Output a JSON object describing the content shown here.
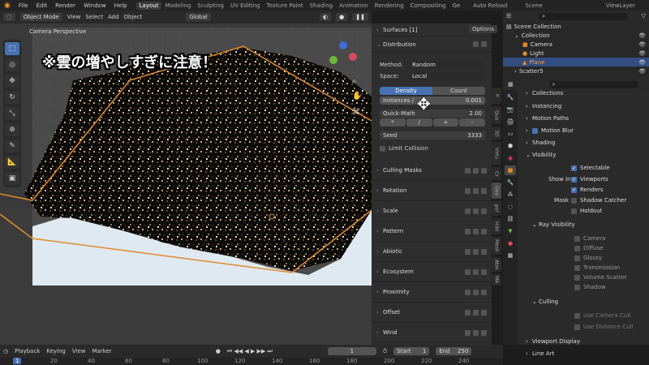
{
  "topbar": {
    "menus": [
      "File",
      "Edit",
      "Render",
      "Window",
      "Help"
    ],
    "workspaces": [
      "Layout",
      "Modeling",
      "Sculpting",
      "UV Editing",
      "Texture Paint",
      "Shading",
      "Animation",
      "Rendering",
      "Compositing",
      "Ge"
    ],
    "auto_reload": "Auto Reload",
    "scene": "Scene",
    "viewlayer": "ViewLayer"
  },
  "viewport": {
    "mode": "Object Mode",
    "menus": [
      "View",
      "Select",
      "Add",
      "Object"
    ],
    "transform": "Global",
    "options": "Options",
    "overlay_text": "※雲の増やしすぎに注意！",
    "camera_label": "Camera Perspective",
    "side_tabs": [
      "P",
      "Qua",
      "3D",
      "Virtu",
      "Cr",
      "Geo",
      "pol",
      "Hdri",
      "Mesh",
      "Atm",
      "MA"
    ]
  },
  "npanel": {
    "surfaces": "Surfaces [1]",
    "distribution": "Distribution",
    "method_label": "Method:",
    "method_value": "Random",
    "space_label": "Space:",
    "space_value": "Local",
    "tab_density": "Density",
    "tab_count": "Count",
    "instances_label": "Instances /",
    "instances_value": "0.001",
    "quickmath": "Quick-Math",
    "quickmath_value": "2.00",
    "ops": [
      "*",
      "/",
      "+",
      "-"
    ],
    "seed_label": "Seed",
    "seed_value": "3333",
    "limit_collision": "Limit Collision",
    "sections": [
      "Culling Masks",
      "Rotation",
      "Scale",
      "Pattern",
      "Abiotic",
      "Ecosystem",
      "Proximity",
      "Offset",
      "Wind"
    ]
  },
  "outliner": {
    "search_placeholder": "",
    "rows": [
      {
        "label": "Scene Collection"
      },
      {
        "label": "Collection"
      },
      {
        "label": "Camera"
      },
      {
        "label": "Light"
      },
      {
        "label": "Plane"
      },
      {
        "label": "Scatter5"
      }
    ]
  },
  "props": {
    "sections_top": [
      "Collections",
      "Instancing",
      "Motion Paths",
      "Motion Blur",
      "Shading",
      "Visibility"
    ],
    "selectable": "Selectable",
    "show_in": "Show In",
    "viewports": "Viewports",
    "renders": "Renders",
    "mask": "Mask",
    "shadow_catcher": "Shadow Catcher",
    "holdout": "Holdout",
    "ray_visibility": "Ray Visibility",
    "rays": [
      "Camera",
      "Diffuse",
      "Glossy",
      "Transmission",
      "Volume Scatter",
      "Shadow"
    ],
    "culling": "Culling",
    "use_camera_cull": "Use Camera Cull",
    "use_distance_cull": "Use Distance Cull",
    "viewport_display": "Viewport Display",
    "line_art": "Line Art"
  },
  "timeline": {
    "menus": [
      "Playback",
      "Keying",
      "View",
      "Marker"
    ],
    "current_frame": "1",
    "start_label": "Start",
    "start": "1",
    "end_label": "End",
    "end": "250",
    "ticks": [
      "1",
      "20",
      "40",
      "60",
      "80",
      "100",
      "120",
      "140",
      "160",
      "180",
      "200",
      "220",
      "240"
    ]
  },
  "colors": {
    "accent": "#4772b3",
    "selection": "#334d80",
    "orange": "#e08a2a"
  }
}
